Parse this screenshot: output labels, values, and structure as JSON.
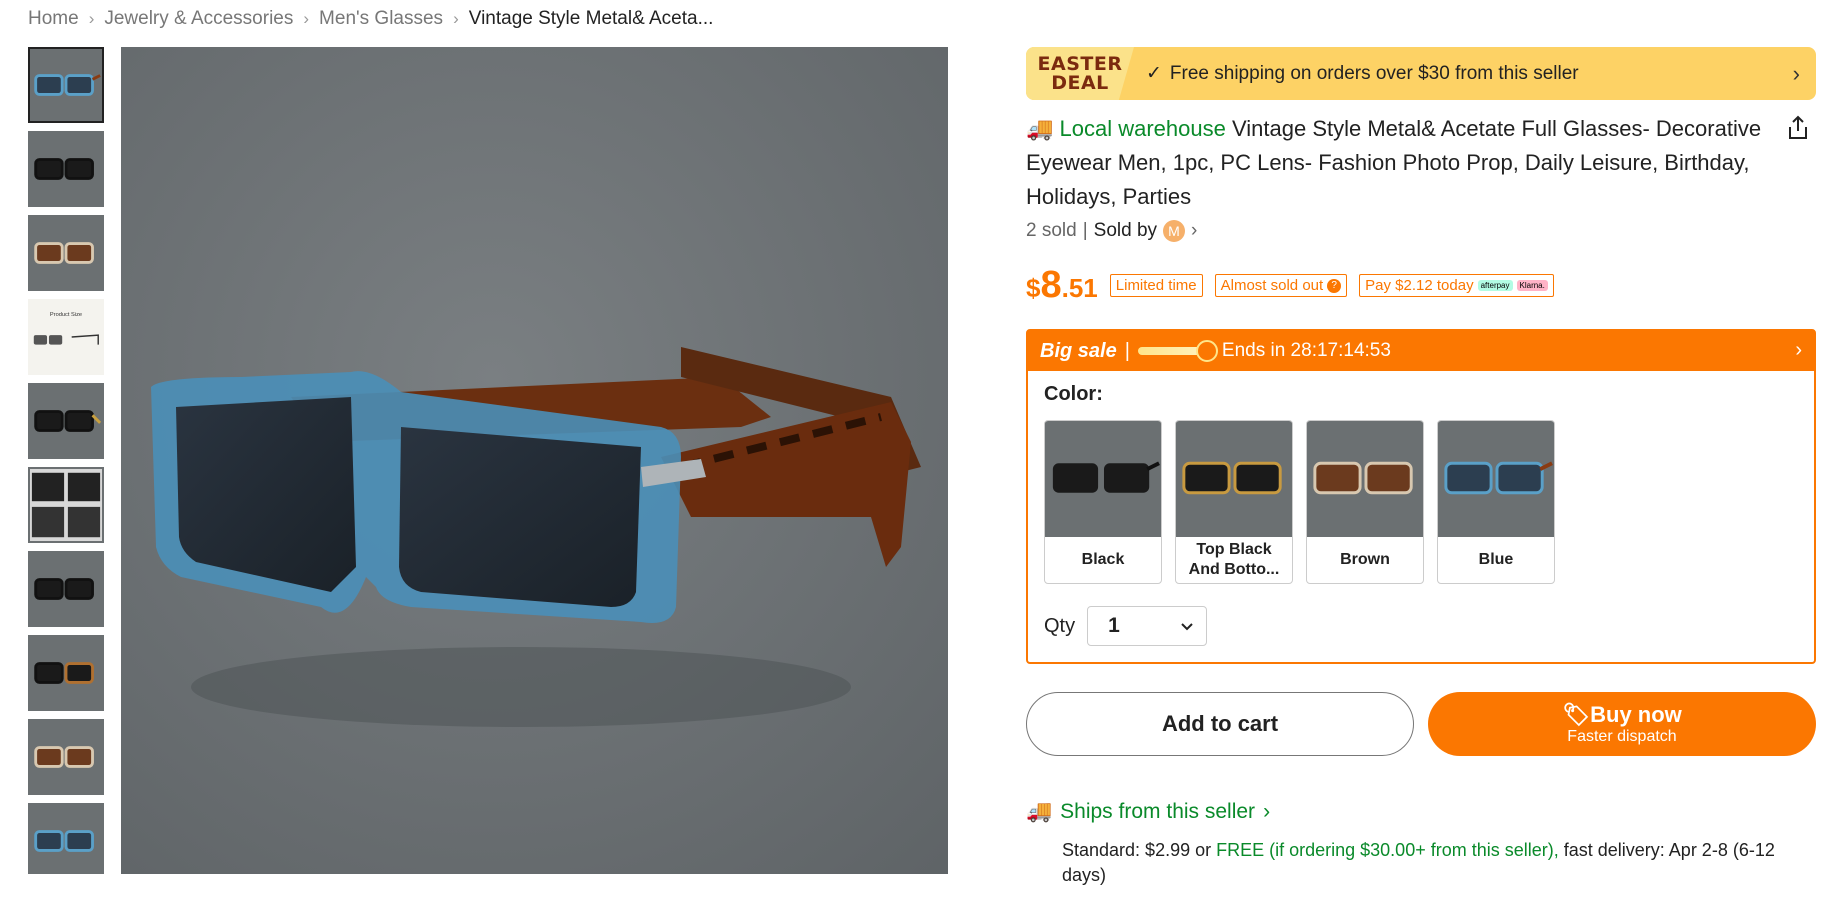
{
  "breadcrumb": {
    "items": [
      "Home",
      "Jewelry & Accessories",
      "Men's Glasses",
      "Vintage Style Metal& Aceta..."
    ]
  },
  "thumbnails": [
    {
      "name": "blue"
    },
    {
      "name": "black"
    },
    {
      "name": "brown"
    },
    {
      "name": "product-size",
      "label": "Product Size"
    },
    {
      "name": "black-2"
    },
    {
      "name": "black-set"
    },
    {
      "name": "black-3"
    },
    {
      "name": "tortoise"
    },
    {
      "name": "brown-2"
    },
    {
      "name": "blue-2"
    }
  ],
  "banner": {
    "logo_line1": "EASTER",
    "logo_line2": "DEAL",
    "text": "Free shipping on orders over $30 from this seller"
  },
  "product": {
    "local_label": "Local warehouse",
    "title": "Vintage Style Metal& Acetate Full Glasses- Decorative Eyewear Men, 1pc, PC Lens- Fashion Photo Prop, Daily Leisure, Birthday, Holidays, Parties",
    "sold": "2 sold",
    "divider": "|",
    "sold_by": "Sold by",
    "seller_initial": "M"
  },
  "price": {
    "currency": "$",
    "integer": "8",
    "decimal": ".51",
    "tags": {
      "limited": "Limited time",
      "almost": "Almost sold out",
      "pay": "Pay $2.12 today",
      "afterpay": "afterpay",
      "klarna": "Klarna."
    }
  },
  "sale": {
    "label": "Big sale",
    "divider": "|",
    "ends": "Ends in 28:17:14:53",
    "color_label": "Color:",
    "colors": [
      "Black",
      "Top Black And Botto...",
      "Brown",
      "Blue"
    ],
    "qty_label": "Qty",
    "qty_value": "1"
  },
  "buttons": {
    "add_to_cart": "Add to cart",
    "buy_now": "Buy now",
    "buy_sub": "Faster dispatch"
  },
  "shipping": {
    "title": "Ships from this seller",
    "standard": "Standard: $2.99 or ",
    "free": "FREE (if ordering $30.00+ from this seller),",
    "fast": " fast delivery: Apr 2-8 (6-12 days)"
  },
  "colors": {
    "accent": "#fb7701",
    "green": "#0a8a2a",
    "banner": "#fdd265"
  }
}
